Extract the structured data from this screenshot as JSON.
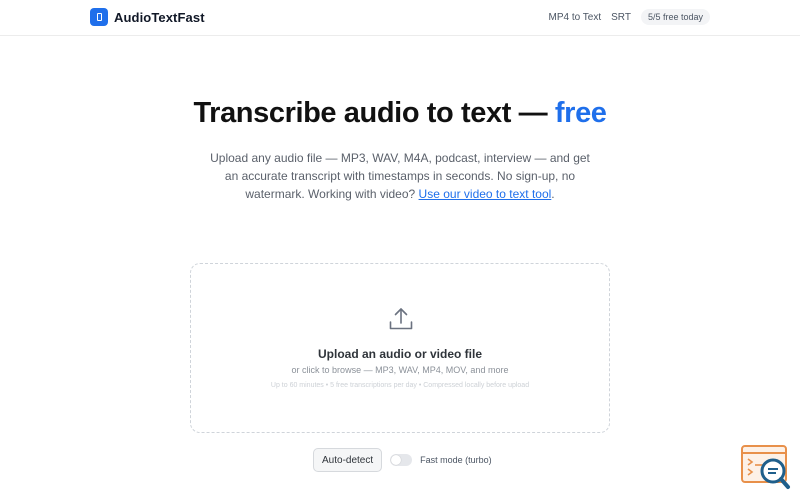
{
  "header": {
    "brand": "AudioTextFast",
    "nav": {
      "mp4_to_text": "MP4 to Text",
      "srt": "SRT"
    },
    "quota_badge": "5/5 free today"
  },
  "hero": {
    "title_main": "Transcribe audio to text — ",
    "title_accent": "free",
    "subtitle": "Upload any audio file — MP3, WAV, M4A, podcast, interview — and get an accurate transcript with timestamps in seconds. No sign-up, no watermark. Working with video? ",
    "video_link": "Use our video to text tool",
    "subtitle_end": "."
  },
  "upload": {
    "title": "Upload an audio or video file",
    "subtitle": "or click to browse — MP3, WAV, MP4, MOV, and more",
    "note": "Up to 60 minutes • 5 free transcriptions per day • Compressed locally before upload"
  },
  "controls": {
    "language": "Auto-detect",
    "fast_mode_label": "Fast mode (turbo)",
    "fast_mode_on": false
  },
  "colors": {
    "accent": "#1f6feb",
    "widget": "#e8904a"
  },
  "icons": {
    "brand": "file-icon",
    "upload": "upload-icon",
    "widget": "search-document-icon"
  }
}
